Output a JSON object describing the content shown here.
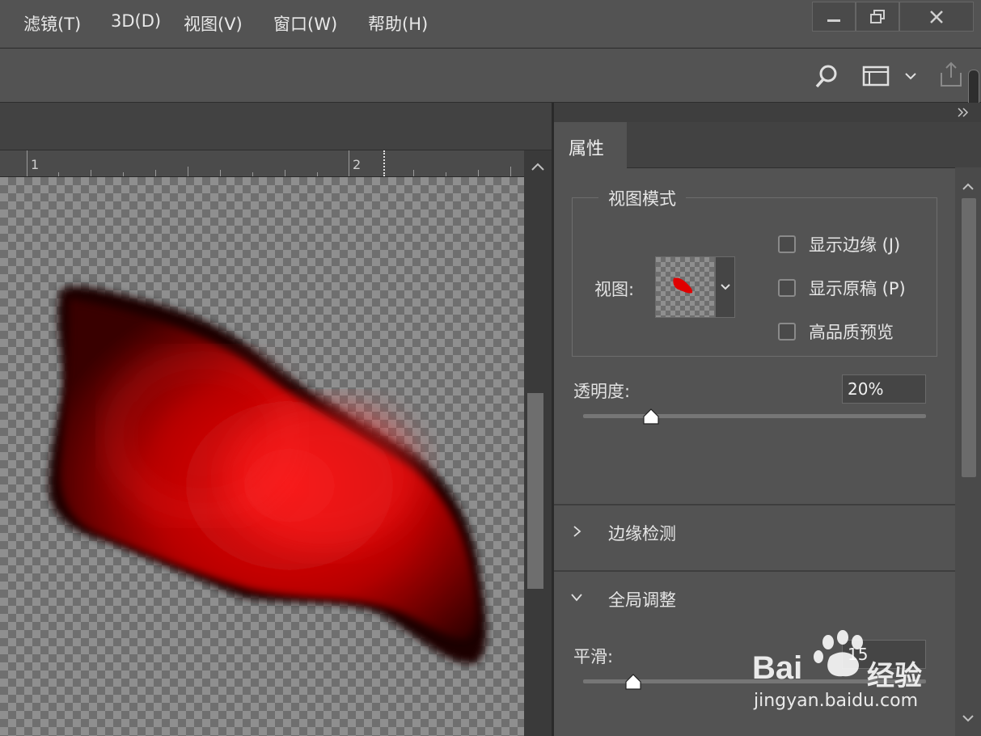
{
  "menu": {
    "items": [
      {
        "label": "滤镜(T)"
      },
      {
        "label": "3D(D)"
      },
      {
        "label": "视图(V)"
      },
      {
        "label": "窗口(W)"
      },
      {
        "label": "帮助(H)"
      }
    ]
  },
  "toolbar": {
    "icons": [
      "search-icon",
      "workspace-icon",
      "chevron-down-icon",
      "share-icon"
    ]
  },
  "ruler": {
    "labels": [
      "1",
      "2"
    ]
  },
  "panel": {
    "tab_label": "属性",
    "view_mode": {
      "legend": "视图模式",
      "view_label": "视图:",
      "options": [
        {
          "label": "显示边缘 (J)",
          "checked": false
        },
        {
          "label": "显示原稿 (P)",
          "checked": false
        },
        {
          "label": "高品质预览",
          "checked": false
        }
      ]
    },
    "opacity": {
      "label": "透明度:",
      "value": "20%",
      "slider_fraction": 0.2
    },
    "edge_detection": {
      "label": "边缘检测"
    },
    "global_refine": {
      "label": "全局调整",
      "smooth_label": "平滑:",
      "smooth_value": "15"
    }
  },
  "watermark": {
    "brand": "Bai",
    "brand_suffix": "经验",
    "url": "jingyan.baidu.com"
  },
  "colors": {
    "accent_red": "#ff1a1a",
    "chrome_dark": "#535353"
  }
}
